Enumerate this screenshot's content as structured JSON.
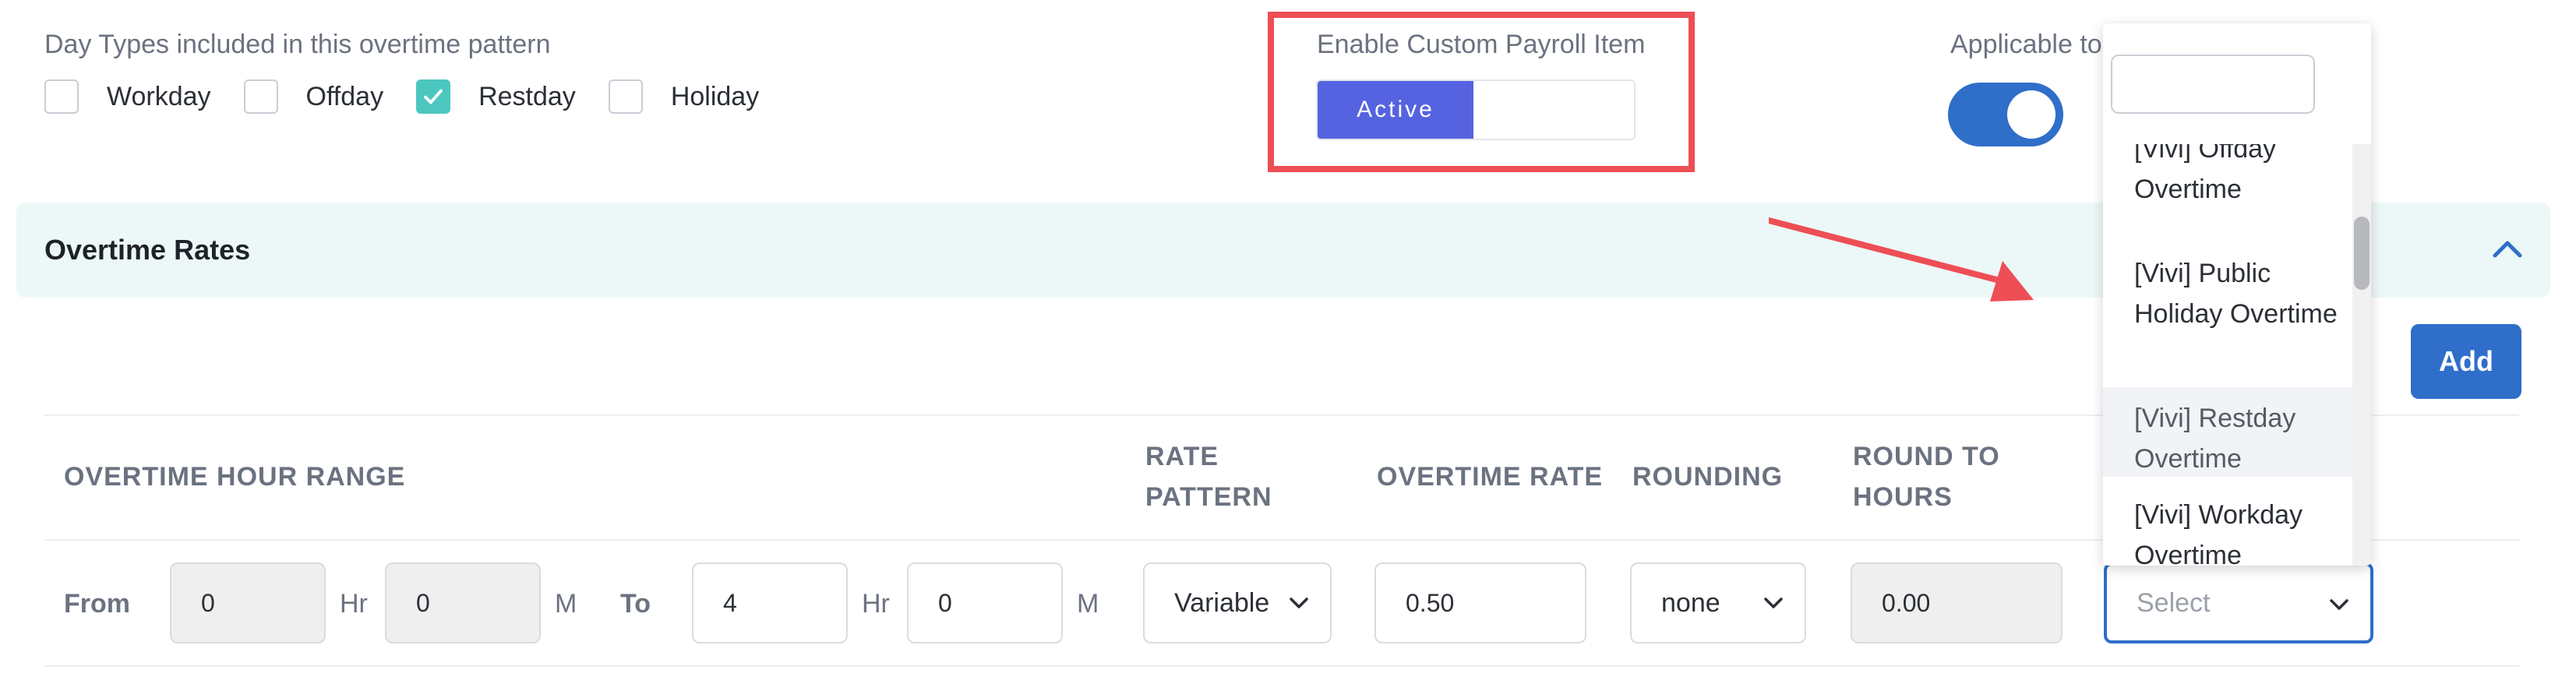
{
  "day_types": {
    "title": "Day Types included in this overtime pattern",
    "options": [
      {
        "label": "Workday",
        "checked": false
      },
      {
        "label": "Offday",
        "checked": false
      },
      {
        "label": "Restday",
        "checked": true
      },
      {
        "label": "Holiday",
        "checked": false
      }
    ]
  },
  "custom_payroll": {
    "label": "Enable Custom Payroll Item",
    "active_label": "Active"
  },
  "applicable": {
    "label": "Applicable to",
    "toggle_on": true
  },
  "overtime_rates": {
    "title": "Overtime Rates",
    "add_label": "Add"
  },
  "table": {
    "headers": {
      "hour_range": "OVERTIME HOUR RANGE",
      "rate_pattern": "RATE PATTERN",
      "overtime_rate": "OVERTIME RATE",
      "rounding": "ROUNDING",
      "round_to_hours": "ROUND TO HOURS"
    },
    "row": {
      "from_label": "From",
      "from_hr": "0",
      "from_m": "0",
      "to_label": "To",
      "to_hr": "4",
      "to_m": "0",
      "hr_unit": "Hr",
      "m_unit": "M",
      "rate_pattern": "Variable",
      "overtime_rate": "0.50",
      "rounding": "none",
      "round_to_hours": "0.00",
      "payroll_item_placeholder": "Select"
    }
  },
  "dropdown": {
    "search_value": "",
    "items": [
      "[Vivi] Offday Overtime",
      "[Vivi] Public Holiday Overtime",
      "[Vivi] Restday Overtime",
      "[Vivi] Workday Overtime"
    ],
    "hovered_index": 2
  },
  "colors": {
    "accent_purple": "#5663e0",
    "accent_blue": "#2f6ec9",
    "highlight_red": "#ee4e55",
    "check_teal": "#4cc7c0",
    "section_bg": "#ecf8f7"
  }
}
